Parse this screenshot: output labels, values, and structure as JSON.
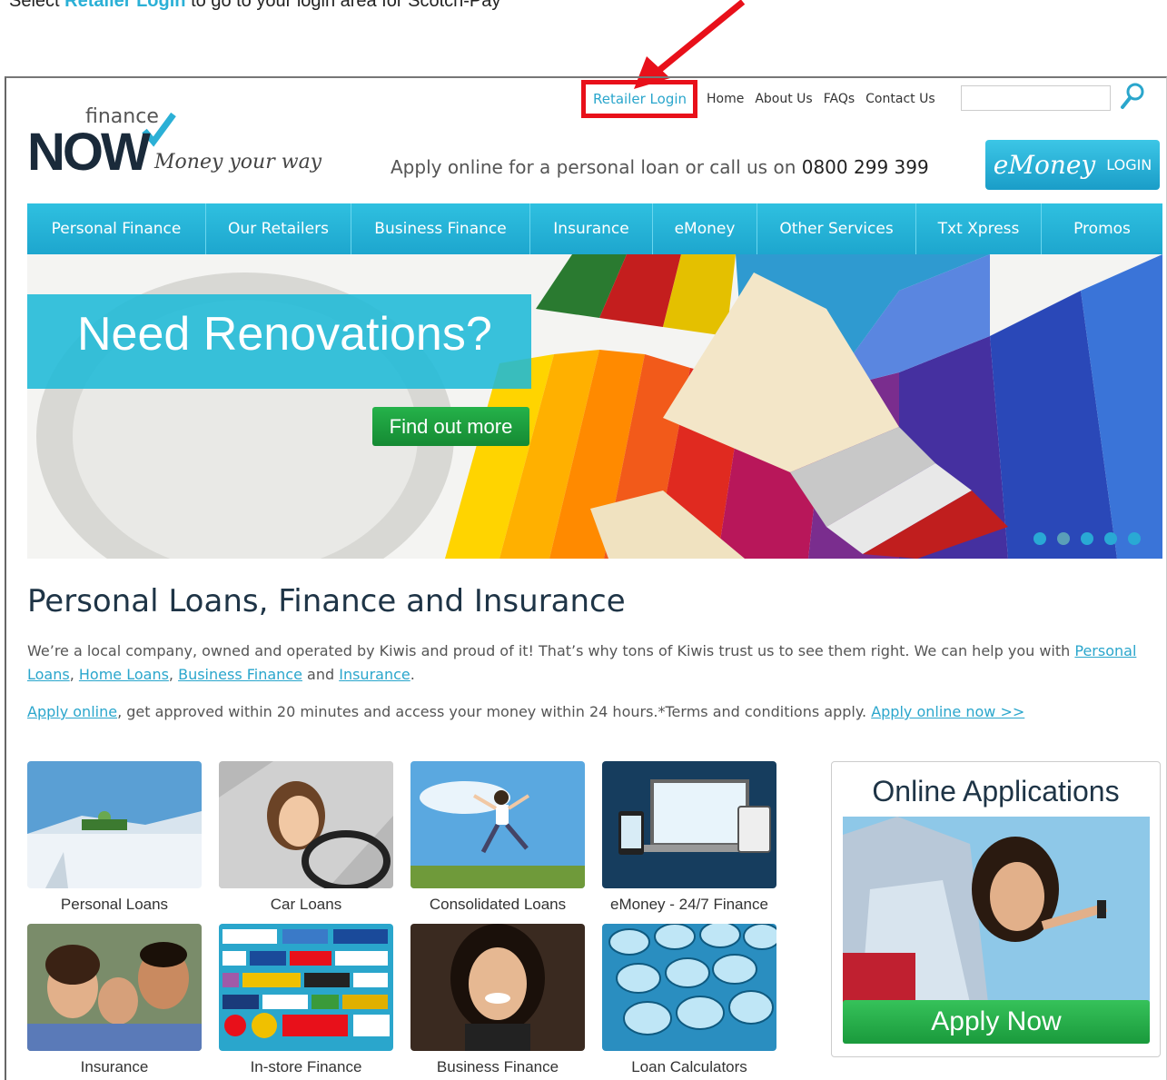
{
  "instruction": {
    "prefix": "Select",
    "highlight": "Retailer Login",
    "suffix": "to go to your login area for Scotch-Pay"
  },
  "header": {
    "logo_finance": "finance",
    "logo_now": "NOW",
    "logo_tagline": "Money your way",
    "retailer_login": "Retailer Login",
    "top_links": [
      "Home",
      "About Us",
      "FAQs",
      "Contact Us"
    ],
    "search_placeholder": "",
    "apply_text": "Apply online for a personal loan or call us on",
    "phone": "0800 299 399",
    "emoney_script": "eMoney",
    "emoney_login": "LOGIN"
  },
  "nav": [
    "Personal Finance",
    "Our Retailers",
    "Business Finance",
    "Insurance",
    "eMoney",
    "Other Services",
    "Txt Xpress",
    "Promos"
  ],
  "hero": {
    "title": "Need Renovations?",
    "cta": "Find out more",
    "slides": 5,
    "active_slide": 1
  },
  "content": {
    "heading": "Personal Loans, Finance and Insurance",
    "p1_text": "We’re a local company, owned and operated by Kiwis and proud of it! That’s why tons of Kiwis trust us to see them right. We can help you with ",
    "p1_link_personal": "Personal Loans",
    "p1_sep1": ", ",
    "p1_link_home": "Home Loans",
    "p1_sep2": ", ",
    "p1_link_business": "Business Finance",
    "p1_and": " and ",
    "p1_link_insurance": "Insurance",
    "p1_end": ".",
    "p2_link_apply": "Apply online",
    "p2_text": ", get approved within 20 minutes and access your money within 24 hours.*Terms and conditions apply. ",
    "p2_link_now": "Apply online now >>"
  },
  "tiles": [
    "Personal Loans",
    "Car Loans",
    "Consolidated Loans",
    "eMoney - 24/7 Finance",
    "Insurance",
    "In-store Finance",
    "Business Finance",
    "Loan Calculators"
  ],
  "side": {
    "title": "Online Applications",
    "button": "Apply Now"
  },
  "colors": {
    "accent": "#1da6ce",
    "green": "#1a9a3c",
    "highlight_box": "#e8101a"
  }
}
